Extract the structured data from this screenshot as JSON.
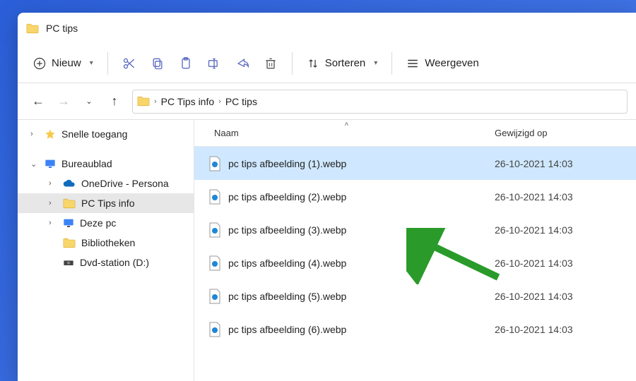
{
  "titlebar": {
    "title": "PC tips"
  },
  "toolbar": {
    "new_label": "Nieuw",
    "sort_label": "Sorteren",
    "view_label": "Weergeven"
  },
  "breadcrumb": {
    "segment1": "PC Tips info",
    "segment2": "PC tips"
  },
  "sidebar": {
    "quick": "Snelle toegang",
    "desktop": "Bureaublad",
    "onedrive": "OneDrive - Persona",
    "pctips": "PC Tips info",
    "thispc": "Deze pc",
    "libraries": "Bibliotheken",
    "dvd": "Dvd-station (D:)"
  },
  "columns": {
    "name": "Naam",
    "modified": "Gewijzigd op"
  },
  "files": [
    {
      "name": "pc tips afbeelding (1).webp",
      "date": "26-10-2021 14:03"
    },
    {
      "name": "pc tips afbeelding (2).webp",
      "date": "26-10-2021 14:03"
    },
    {
      "name": "pc tips afbeelding (3).webp",
      "date": "26-10-2021 14:03"
    },
    {
      "name": "pc tips afbeelding (4).webp",
      "date": "26-10-2021 14:03"
    },
    {
      "name": "pc tips afbeelding (5).webp",
      "date": "26-10-2021 14:03"
    },
    {
      "name": "pc tips afbeelding (6).webp",
      "date": "26-10-2021 14:03"
    }
  ],
  "colors": {
    "accent": "#cfe8ff",
    "arrow": "#2a9b2a"
  }
}
